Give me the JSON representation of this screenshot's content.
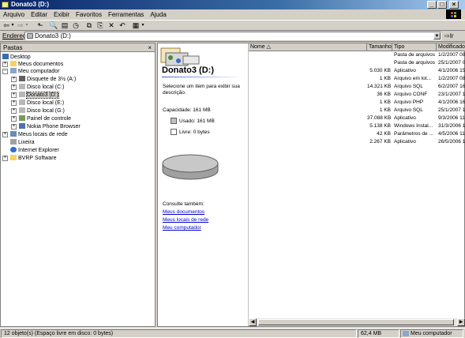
{
  "window": {
    "title": "Donato3 (D:)"
  },
  "menu": [
    "Arquivo",
    "Editar",
    "Exibir",
    "Favoritos",
    "Ferramentas",
    "Ajuda"
  ],
  "address": {
    "label": "Endereço",
    "value": "Donato3 (D:)",
    "go": "Ir"
  },
  "folders": {
    "header": "Pastas",
    "close": "×",
    "items": [
      {
        "label": "Desktop"
      },
      {
        "label": "Meus documentos"
      },
      {
        "label": "Meu computador"
      },
      {
        "label": "Disquete de 3½ (A:)"
      },
      {
        "label": "Disco local (C:)"
      },
      {
        "label": "Donato3 (D:)"
      },
      {
        "label": "Disco local (E:)"
      },
      {
        "label": "Disco local (G:)"
      },
      {
        "label": "Painel de controle"
      },
      {
        "label": "Nokia Phone Browser"
      },
      {
        "label": "Meus locais de rede"
      },
      {
        "label": "Lixeira"
      },
      {
        "label": "Internet Explorer"
      },
      {
        "label": "BVRP Software"
      }
    ]
  },
  "webview": {
    "title": "Donato3 (D:)",
    "hint": "Selecione um item para exibir sua descrição.",
    "capacity": "Capacidade: 161 MB",
    "used": "Usado: 161 MB",
    "free": "Livre: 0 bytes",
    "used_fraction": 1.0,
    "see_also": "Consulte também:",
    "links": [
      "Meus documentos",
      "Meus locais de rede",
      "Meu computador"
    ]
  },
  "columns": [
    "Nome",
    "Tamanho",
    "Tipo",
    "Modificado"
  ],
  "files": [
    {
      "name": "donato",
      "size": "",
      "type": "Pasta de arquivos",
      "modified": "1/2/2007 08",
      "icon": "folder"
    },
    {
      "name": "PHP",
      "size": "",
      "type": "Pasta de arquivos",
      "modified": "25/1/2007 0",
      "icon": "folder"
    },
    {
      "name": "apache_1.3.34-win32-x86-no_src.exe",
      "size": "5.030 KB",
      "type": "Aplicativo",
      "modified": "4/1/2006 15",
      "icon": "exe"
    },
    {
      "name": "copia.bat",
      "size": "1 KB",
      "type": "Arquivo em lot...",
      "modified": "1/2/2007 08",
      "icon": "bat"
    },
    {
      "name": "database_donato.sql",
      "size": "14.321 KB",
      "type": "Arquivo SQL",
      "modified": "6/2/2007 16",
      "icon": "sql"
    },
    {
      "name": "httpd.conf",
      "size": "36 KB",
      "type": "Arquivo CONF",
      "modified": "23/1/2007 1",
      "icon": "conf"
    },
    {
      "name": "info.php",
      "size": "1 KB",
      "type": "Arquivo PHP",
      "modified": "4/1/2006 16",
      "icon": "php"
    },
    {
      "name": "manut.sql",
      "size": "1 KB",
      "type": "Arquivo SQL",
      "modified": "25/1/2007 1",
      "icon": "sql"
    },
    {
      "name": "MySQL_Setup.exe",
      "size": "37.088 KB",
      "type": "Aplicativo",
      "modified": "9/3/2006 11",
      "icon": "exe"
    },
    {
      "name": "mysql-administrator-1.1.9-win.msi",
      "size": "5.138 KB",
      "type": "Windows Instal...",
      "modified": "31/3/2006 1",
      "icon": "msi"
    },
    {
      "name": "php.ini",
      "size": "42 KB",
      "type": "Parâmetros de ...",
      "modified": "4/5/2006 11",
      "icon": "ini"
    },
    {
      "name": "php-5.0.3-installer.exe",
      "size": "2.267 KB",
      "type": "Aplicativo",
      "modified": "26/5/2006 1",
      "icon": "exe"
    }
  ],
  "status": {
    "objects": "12 objeto(s) (Espaço livre em disco: 0 bytes)",
    "size": "62,4 MB",
    "location": "Meu computador"
  },
  "colors": {
    "folder": "#f4d35e",
    "link": "#0000cc",
    "titlebar": "#0a246a",
    "used": "#c0c0c0"
  }
}
